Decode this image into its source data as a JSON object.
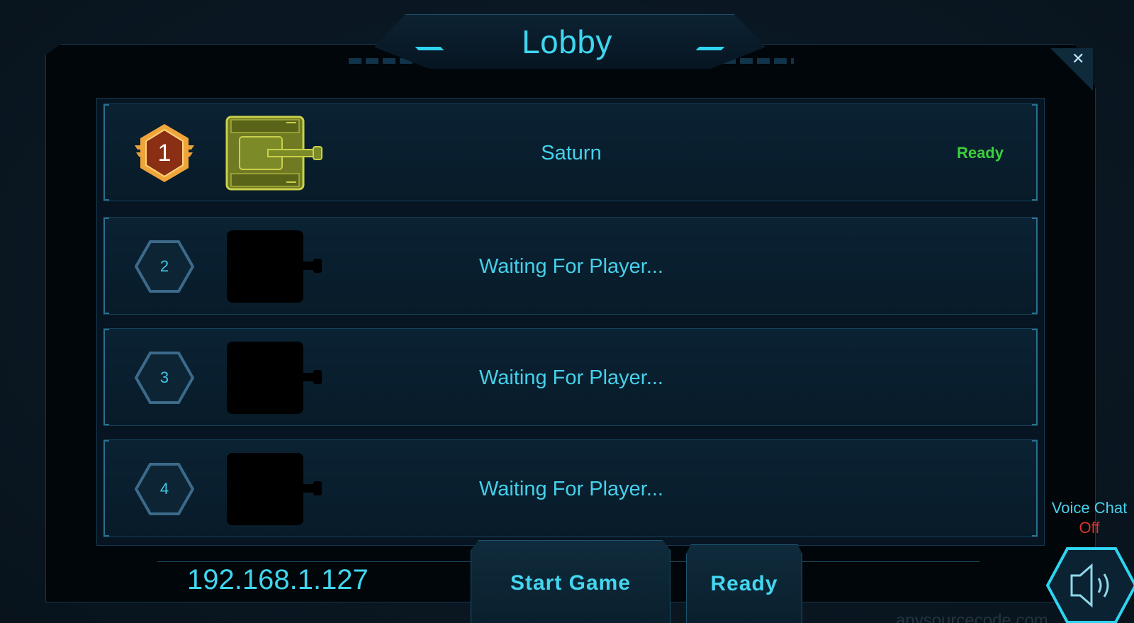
{
  "lobby": {
    "title": "Lobby",
    "close_icon": "close-icon",
    "players": [
      {
        "slot": "1",
        "name": "Saturn",
        "status": "Ready",
        "occupied": true
      },
      {
        "slot": "2",
        "name": "Waiting For Player...",
        "status": "",
        "occupied": false
      },
      {
        "slot": "3",
        "name": "Waiting For Player...",
        "status": "",
        "occupied": false
      },
      {
        "slot": "4",
        "name": "Waiting For Player...",
        "status": "",
        "occupied": false
      }
    ]
  },
  "footer": {
    "ip_address": "192.168.1.127",
    "start_label": "Start Game",
    "ready_label": "Ready"
  },
  "voice_chat": {
    "label": "Voice Chat",
    "state": "Off",
    "icon": "speaker-icon"
  },
  "colors": {
    "accent": "#3fd6ef",
    "ready_green": "#3ccf3a",
    "off_red": "#d9352c",
    "gold_badge": "#e8902a"
  }
}
